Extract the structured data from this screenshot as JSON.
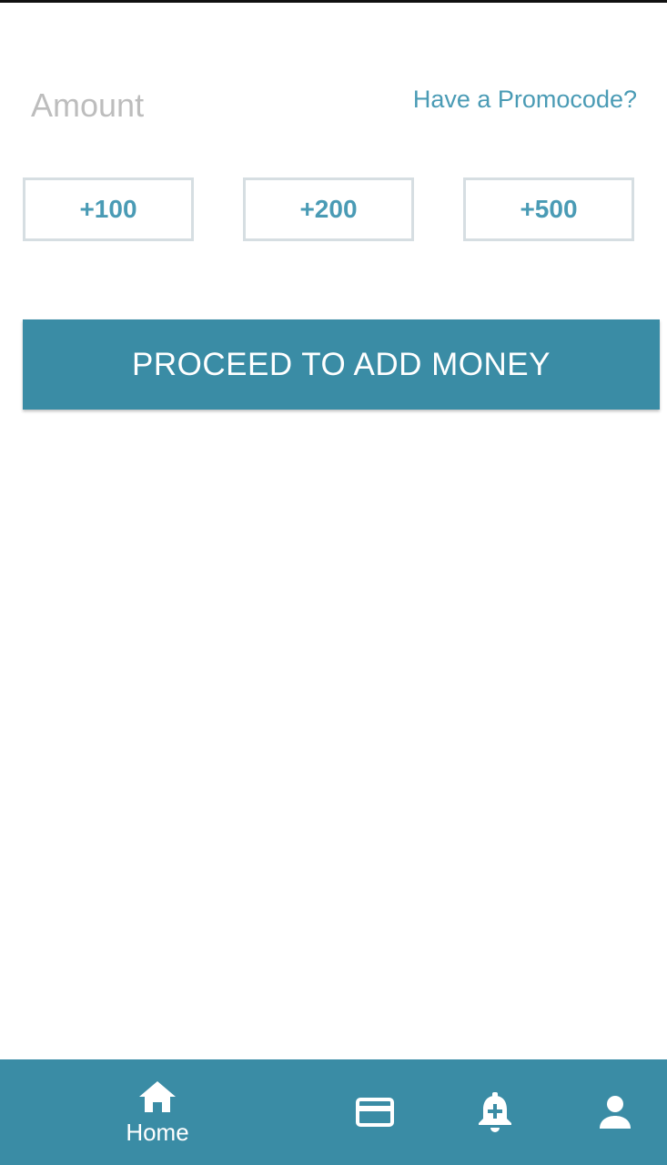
{
  "amount": {
    "placeholder": "Amount",
    "value": ""
  },
  "promo": {
    "label": "Have a Promocode?"
  },
  "quick_amounts": [
    "+100",
    "+200",
    "+500"
  ],
  "proceed": {
    "label": "PROCEED TO ADD MONEY"
  },
  "bottom_nav": {
    "items": [
      {
        "label": "Home",
        "icon": "home-icon",
        "active": true
      },
      {
        "label": "",
        "icon": "credit-card-icon"
      },
      {
        "label": "",
        "icon": "bell-plus-icon"
      },
      {
        "label": "",
        "icon": "person-icon"
      }
    ]
  },
  "colors": {
    "accent": "#3a8ca5",
    "link": "#4a9bb5",
    "chip_border": "#d6dee2",
    "placeholder": "#bdbdbd"
  }
}
